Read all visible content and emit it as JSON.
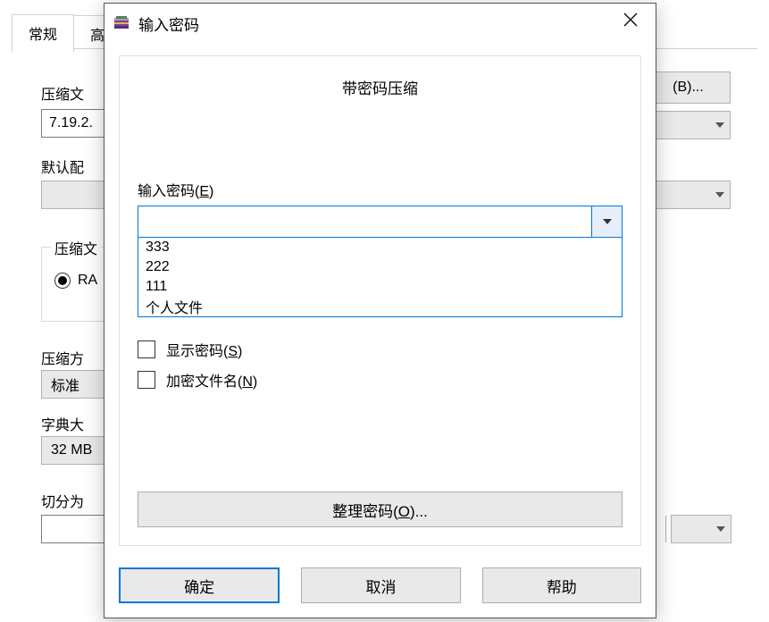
{
  "bg": {
    "tabs": {
      "general": "常规",
      "other": "高"
    },
    "labels": {
      "archive_name": "压缩文",
      "default_profile": "默认配",
      "archive_format_group": "压缩文",
      "method": "压缩方",
      "dict": "字典大",
      "split": "切分为"
    },
    "fields": {
      "archive_name": "7.19.2.",
      "method_value": "标准",
      "dict_value": "32 MB"
    },
    "radio_rar": "RA",
    "browse_button": "(B)..."
  },
  "dialog": {
    "title": "输入密码",
    "heading": "带密码压缩",
    "password_label_pre": "输入密码(",
    "password_label_key": "E",
    "password_label_post": ")",
    "password_value": "",
    "options": [
      "333",
      "222",
      "111",
      "个人文件"
    ],
    "show_password_pre": "显示密码(",
    "show_password_key": "S",
    "show_password_post": ")",
    "encrypt_names_pre": "加密文件名(",
    "encrypt_names_key": "N",
    "encrypt_names_post": ")",
    "organize_pre": "整理密码(",
    "organize_key": "O",
    "organize_post": ")...",
    "ok": "确定",
    "cancel": "取消",
    "help": "帮助"
  }
}
